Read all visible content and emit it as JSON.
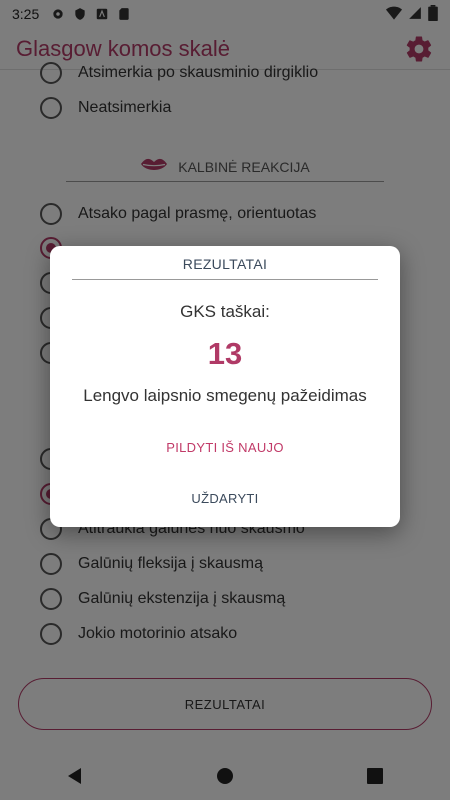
{
  "status_bar": {
    "time": "3:25"
  },
  "app_bar": {
    "title": "Glasgow komos skalė"
  },
  "eye_options": [
    "Atsimerkia po skausminio dirgiklio",
    "Neatsimerkia"
  ],
  "verbal_section": {
    "title": "KALBINĖ REAKCIJA"
  },
  "verbal_options": [
    {
      "label": "Atsako pagal prasmę, orientuotas",
      "checked": false
    },
    {
      "label": "",
      "checked": true
    },
    {
      "label": "",
      "checked": false
    },
    {
      "label": "",
      "checked": false
    },
    {
      "label": "",
      "checked": false
    }
  ],
  "motor_options": [
    {
      "label": "",
      "checked": false
    },
    {
      "label": "",
      "checked": true
    },
    {
      "label": "Atitraukia galūnes nuo skausmo",
      "checked": false
    },
    {
      "label": "Galūnių fleksija į skausmą",
      "checked": false
    },
    {
      "label": "Galūnių ekstenzija į skausmą",
      "checked": false
    },
    {
      "label": "Jokio motorinio atsako",
      "checked": false
    }
  ],
  "results_button": "REZULTATAI",
  "dialog": {
    "title": "REZULTATAI",
    "score_label": "GKS taškai:",
    "score": "13",
    "severity": "Lengvo laipsnio smegenų pažeidimas",
    "retry_label": "PILDYTI IŠ NAUJO",
    "close_label": "UŽDARYTI"
  },
  "colors": {
    "accent": "#b03a66",
    "dialog_text": "#3b4a5c"
  }
}
